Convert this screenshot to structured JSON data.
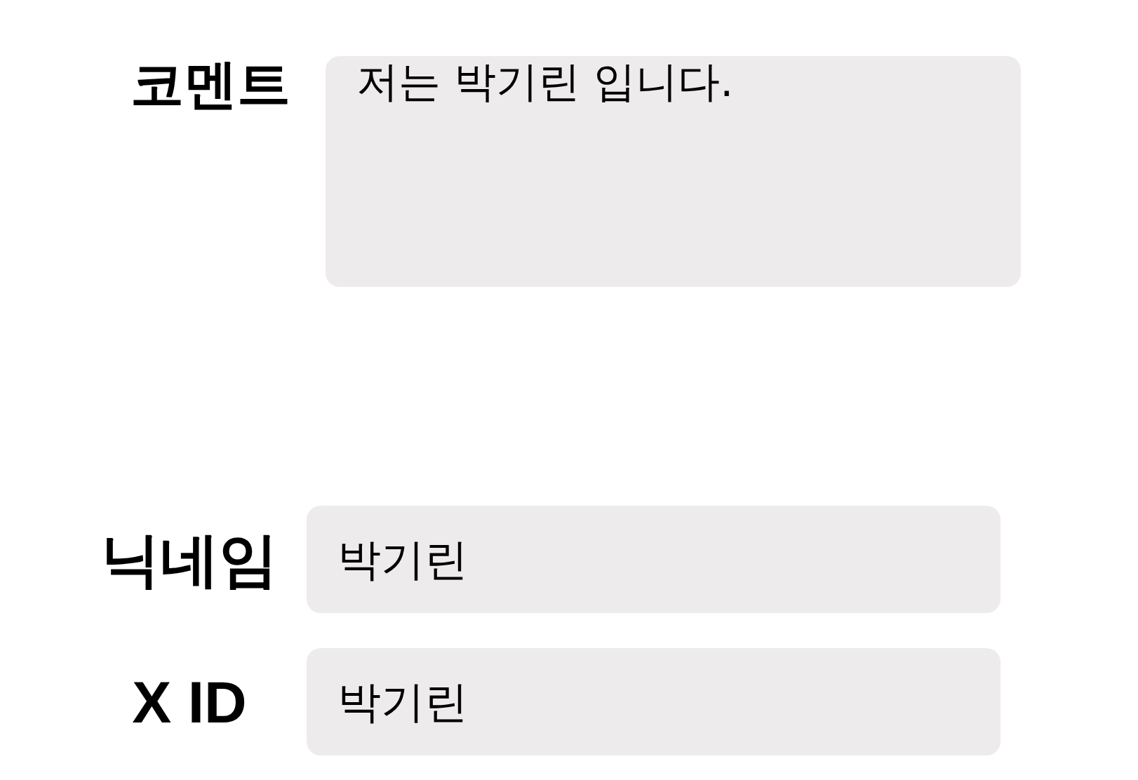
{
  "fields": [
    {
      "kind": "textarea",
      "label": "코멘트",
      "value": "저는 박기린 입니다."
    },
    {
      "kind": "input",
      "label": "닉네임",
      "value": "박기린"
    },
    {
      "kind": "input",
      "label": "X ID",
      "value": "박기린"
    }
  ]
}
